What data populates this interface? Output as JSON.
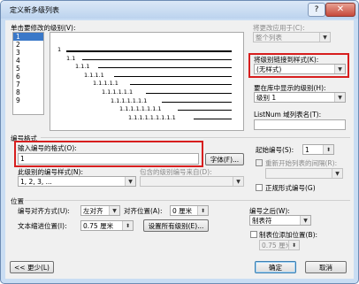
{
  "window": {
    "title": "定义新多级列表",
    "help_icon": "?",
    "close_icon": "✕"
  },
  "level_section": {
    "label": "单击要修改的级别(V):",
    "levels": [
      "1",
      "2",
      "3",
      "4",
      "5",
      "6",
      "7",
      "8",
      "9"
    ],
    "selected": "1"
  },
  "preview": {
    "items": [
      "1",
      "1.1",
      "1.1.1",
      "1.1.1.1",
      "1.1.1.1.1",
      "1.1.1.1.1.1",
      "1.1.1.1.1.1.1",
      "1.1.1.1.1.1.1.1",
      "1.1.1.1.1.1.1.1.1"
    ]
  },
  "apply_to": {
    "label": "将更改应用于(C):",
    "value": "整个列表"
  },
  "link_style": {
    "label": "将级别链接到样式(K):",
    "value": "(无样式)"
  },
  "gallery_level": {
    "label": "要在库中显示的级别(H):",
    "value": "级别 1"
  },
  "listnum": {
    "label": "ListNum 域列表名(T):",
    "value": ""
  },
  "number_format": {
    "section": "编号格式",
    "format_label": "输入编号的格式(O):",
    "format_value": "1",
    "font_button": "字体(F)...",
    "style_label": "此级别的编号样式(N):",
    "style_value": "1, 2, 3, ...",
    "include_label": "包含的级别编号来自(D):",
    "include_value": "",
    "start_label": "起始编号(S):",
    "start_value": "1",
    "restart_label": "重新开始列表的间隔(R):",
    "restart_value": "",
    "legal_label": "正规形式编号(G)"
  },
  "position": {
    "section": "位置",
    "align_label": "编号对齐方式(U):",
    "align_value": "左对齐",
    "align_at_label": "对齐位置(A):",
    "align_at_value": "0 厘米",
    "indent_label": "文本缩进位置(I):",
    "indent_value": "0.75 厘米",
    "set_all_button": "设置所有级别(E)...",
    "follow_label": "编号之后(W):",
    "follow_value": "制表符",
    "tab_check_label": "制表位添加位置(B):",
    "tab_value": "0.75 厘米"
  },
  "footer": {
    "less_button": "<< 更少(L)",
    "ok_button": "确定",
    "cancel_button": "取消"
  }
}
